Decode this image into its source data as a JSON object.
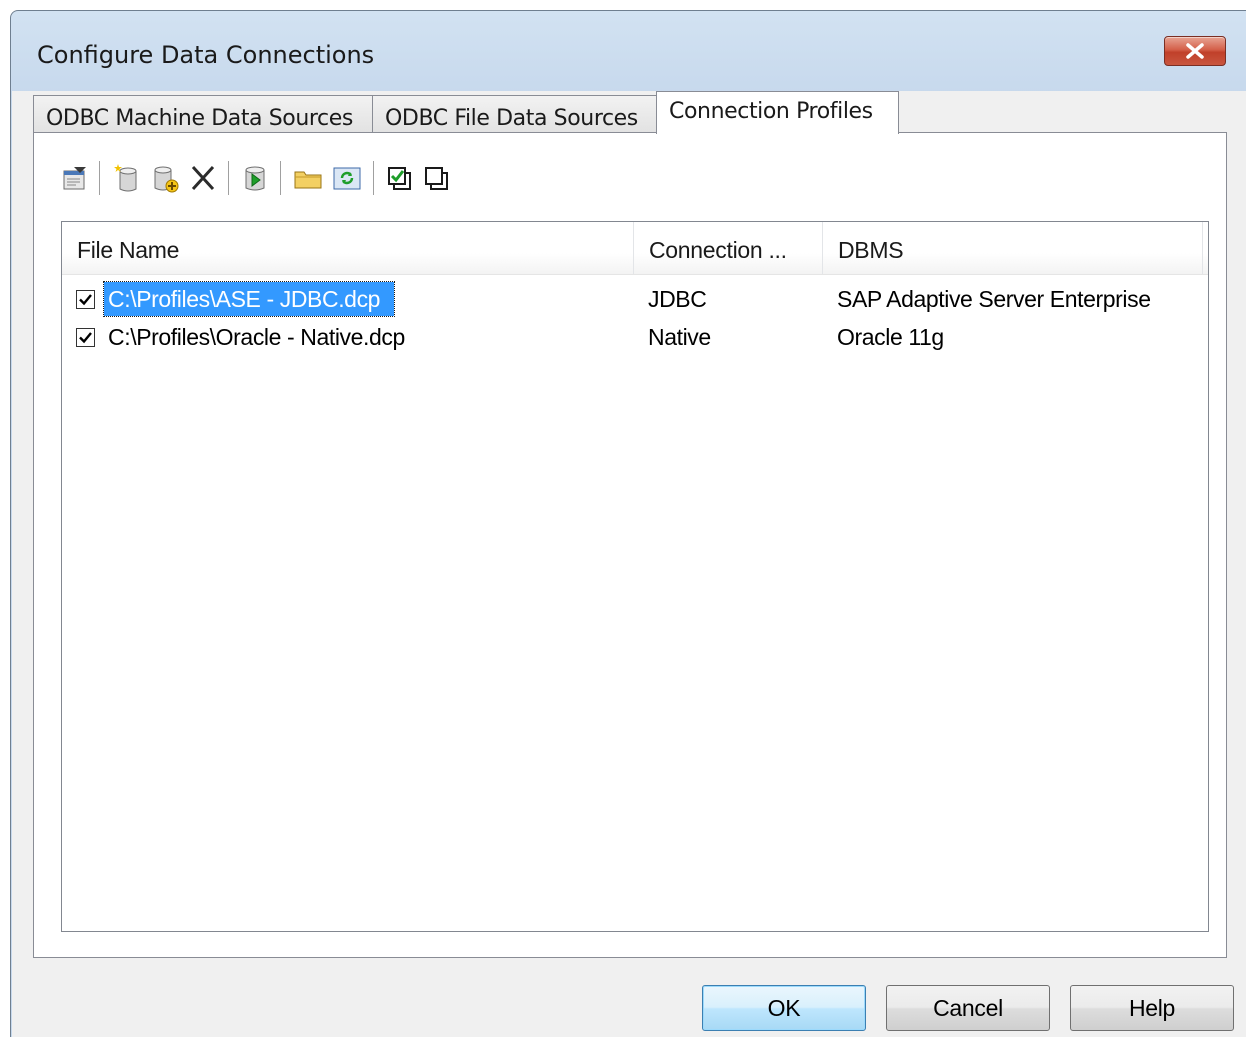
{
  "window": {
    "title": "Configure Data Connections"
  },
  "tabs": [
    {
      "label": "ODBC Machine Data Sources",
      "active": false
    },
    {
      "label": "ODBC File Data Sources",
      "active": false
    },
    {
      "label": "Connection Profiles",
      "active": true
    }
  ],
  "toolbar": {
    "items": [
      "properties-icon",
      "new-connection-icon",
      "add-connection-icon",
      "delete-icon",
      "test-connection-icon",
      "open-folder-icon",
      "refresh-icon",
      "check-all-icon",
      "uncheck-all-icon"
    ]
  },
  "list": {
    "columns": [
      "File Name",
      "Connection ...",
      "DBMS"
    ],
    "rows": [
      {
        "checked": true,
        "file": "C:\\Profiles\\ASE - JDBC.dcp",
        "type": "JDBC",
        "dbms": "SAP Adaptive Server Enterprise",
        "selected": true
      },
      {
        "checked": true,
        "file": "C:\\Profiles\\Oracle - Native.dcp",
        "type": "Native",
        "dbms": "Oracle 11g",
        "selected": false
      }
    ]
  },
  "buttons": {
    "ok": "OK",
    "cancel": "Cancel",
    "help": "Help"
  },
  "colors": {
    "selection": "#3399ff",
    "close_button": "#c9563f",
    "window_frame": "#c6d8ec"
  }
}
